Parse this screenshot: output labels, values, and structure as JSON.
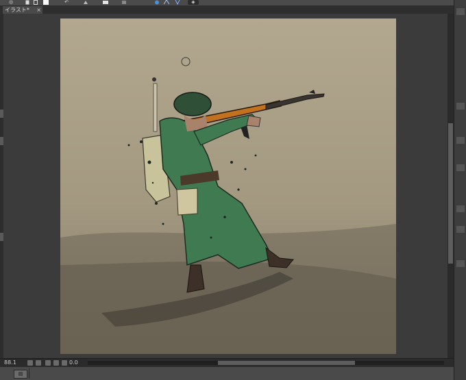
{
  "toolbar": {
    "icons": [
      "eye-icon",
      "document-icon",
      "new-file-icon",
      "color-swatch-icon",
      "undo-icon",
      "transform-icon",
      "clear-icon",
      "navigator-icon",
      "rotate-icon",
      "flip-icon",
      "wand-icon",
      "settings-icon"
    ],
    "glyphs": {
      "eye": "◎",
      "undo": "↶",
      "nav": "◈"
    }
  },
  "tabs": [
    {
      "label": "イラスト*",
      "close": "×"
    }
  ],
  "status": {
    "zoom": "88.1",
    "angle": "0.0"
  },
  "bottom": {
    "layer_button": "▤"
  },
  "colors": {
    "accent": "#4a90d9",
    "canvas_bg": "#a49a83",
    "uniform": "#3f7a51",
    "rifle_wood": "#c2721e"
  }
}
